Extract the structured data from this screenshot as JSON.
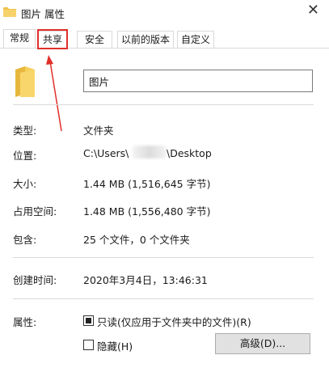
{
  "window": {
    "title": "图片 属性",
    "close_glyph": "✕"
  },
  "tabs": [
    {
      "label": "常规",
      "active": true
    },
    {
      "label": "共享",
      "active": false
    },
    {
      "label": "安全",
      "active": false
    },
    {
      "label": "以前的版本",
      "active": false
    },
    {
      "label": "自定义",
      "active": false
    }
  ],
  "general": {
    "folder_name": "图片",
    "type_label": "类型:",
    "type_value": "文件夹",
    "location_label": "位置:",
    "location_prefix": "C:\\Users\\",
    "location_suffix": "\\Desktop",
    "size_label": "大小:",
    "size_value": "1.44 MB (1,516,645 字节)",
    "disk_size_label": "占用空间:",
    "disk_size_value": "1.48 MB (1,556,480 字节)",
    "contains_label": "包含:",
    "contains_value": "25 个文件，0 个文件夹",
    "created_label": "创建时间:",
    "created_value": "2020年3月4日，13:46:31",
    "attributes_label": "属性:",
    "readonly_label": "只读(仅应用于文件夹中的文件)(R)",
    "readonly_checked": true,
    "hidden_label": "隐藏(H)",
    "hidden_checked": false,
    "advanced_button": "高级(D)..."
  },
  "annotation": {
    "color": "#e0302a"
  }
}
